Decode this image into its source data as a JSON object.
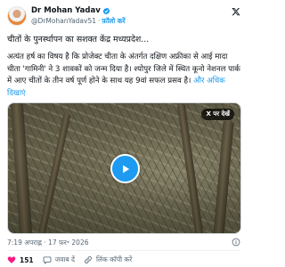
{
  "author": {
    "display_name": "Dr Mohan Yadav",
    "handle": "@DrMohanYadav51",
    "dot": "·",
    "follow_label": "फ़ॉलो करें"
  },
  "post": {
    "lead": "चीतों के पुनर्स्थापन का सशक्त केंद्र मध्यप्रदेश...",
    "body": "अत्यंत हर्ष का विषय है कि प्रोजेक्ट चीता के अंतर्गत दक्षिण अफ्रीका से आई मादा चीता 'गामिनी' ने 3 शावकों को जन्म दिया है। श्योपुर जिले में स्थित कूनो नेशनल पार्क में आए चीतों के तीन वर्ष पूर्ण होने के साथ यह 9वां सफल प्रसव है।",
    "show_more": "और अधिक दिखाएं"
  },
  "media": {
    "watch_label": "X पर देखें",
    "play_icon": "play-icon"
  },
  "meta": {
    "timestamp": "7:19 अपराह्न · 17 फ़र॰ 2026"
  },
  "actions": {
    "like_count": "151",
    "reply_label": "जवाब दें",
    "copy_link_label": "लिंक कॉपी करें"
  },
  "colors": {
    "accent": "#1d9bf0",
    "like": "#f91880",
    "text": "#0f1419",
    "muted": "#536471"
  }
}
